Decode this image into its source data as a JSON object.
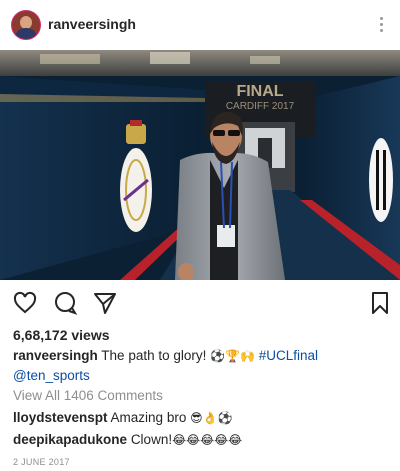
{
  "header": {
    "username": "ranveersingh",
    "avatar_icon": "profile-picture",
    "more_icon": "more-options-vertical-icon"
  },
  "media": {
    "sign_text": "FINAL",
    "sign_subtext": "CARDIFF 2017",
    "colors": {
      "wall": "#0e2b45",
      "carpet": "#b8222a",
      "floor": "#14304a"
    }
  },
  "actions": {
    "like_icon": "heart-icon",
    "comment_icon": "comment-icon",
    "share_icon": "share-icon",
    "save_icon": "bookmark-icon"
  },
  "post": {
    "views": "6,68,172 views",
    "caption_user": "ranveersingh",
    "caption_text": " The path to glory! ",
    "caption_emoji": "⚽🏆🙌",
    "caption_hashtag": "#UCLfinal",
    "caption_mention": "@ten_sports",
    "view_all_comments": "View All 1406 Comments",
    "date": "2 JUNE 2017"
  },
  "comments": [
    {
      "user": "lloydstevenspt",
      "text": "Amazing bro ",
      "emoji": "😎👌⚽"
    },
    {
      "user": "deepikapadukone",
      "text": "Clown!",
      "emoji": "😂😂😂😂😂"
    }
  ]
}
